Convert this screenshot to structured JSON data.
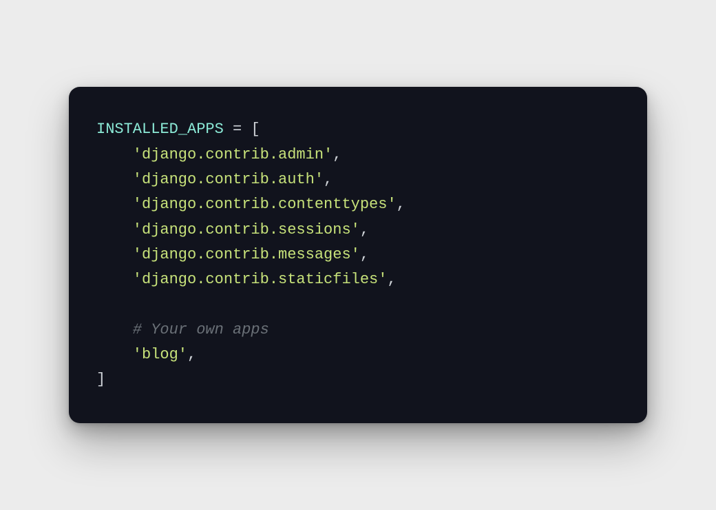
{
  "code": {
    "variable": "INSTALLED_APPS",
    "assign": " = ",
    "lbracket": "[",
    "rbracket": "]",
    "comma": ",",
    "lines": [
      "'django.contrib.admin'",
      "'django.contrib.auth'",
      "'django.contrib.contenttypes'",
      "'django.contrib.sessions'",
      "'django.contrib.messages'",
      "'django.contrib.staticfiles'"
    ],
    "comment": "# Your own apps",
    "own_app": "'blog'"
  }
}
